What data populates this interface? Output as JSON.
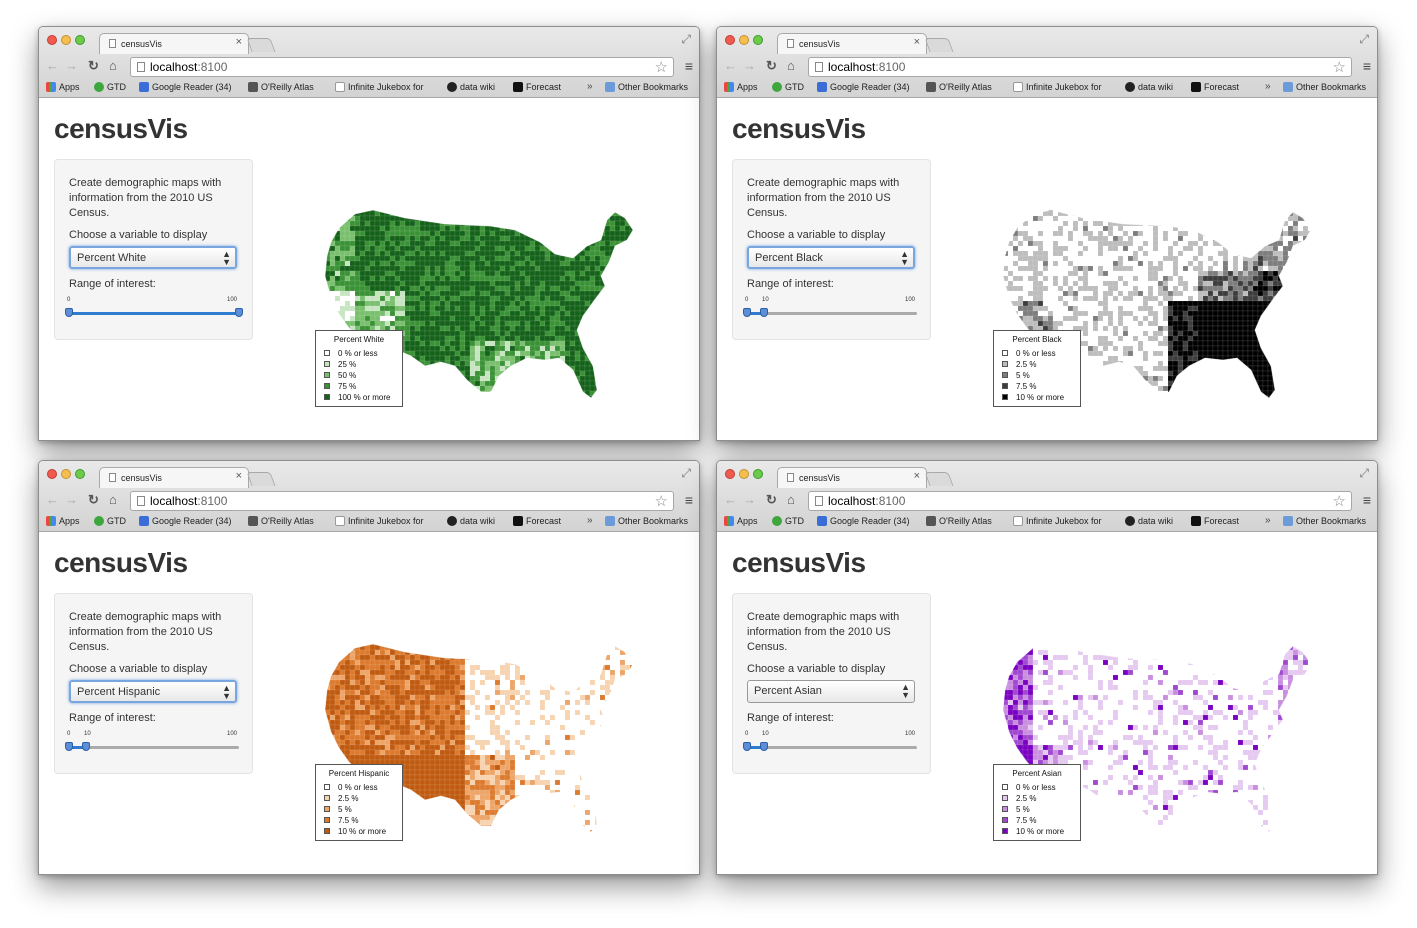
{
  "browser": {
    "tab_title": "censusVis",
    "url_host": "localhost",
    "url_port": ":8100",
    "bookmarks": [
      "Apps",
      "GTD",
      "Google Reader (34)",
      "O'Reilly Atlas",
      "Infinite Jukebox for",
      "data wiki",
      "Forecast"
    ],
    "bookmarks_overflow": "»",
    "other_bookmarks": "Other Bookmarks"
  },
  "app": {
    "title": "censusVis",
    "intro": "Create demographic maps with information from the 2010 US Census.",
    "variable_label": "Choose a variable to display",
    "range_label": "Range of interest:"
  },
  "windows": [
    {
      "variable": "Percent White",
      "slider": {
        "min": 0,
        "max": 100,
        "low": 0,
        "high": 100
      },
      "slider_ticks": [
        "0",
        "100"
      ],
      "select_focused": true,
      "legend_title": "Percent White",
      "legend": [
        "0 % or less",
        "25 %",
        "50 %",
        "75 %",
        "100 % or more"
      ],
      "colors": [
        "#ffffff",
        "#c7e5c1",
        "#79bf6e",
        "#3a9136",
        "#14611a"
      ]
    },
    {
      "variable": "Percent Black",
      "slider": {
        "min": 0,
        "max": 100,
        "low": 0,
        "high": 10
      },
      "slider_ticks": [
        "0",
        "10",
        "100"
      ],
      "select_focused": true,
      "legend_title": "Percent Black",
      "legend": [
        "0 % or less",
        "2.5 %",
        "5 %",
        "7.5 %",
        "10 % or more"
      ],
      "colors": [
        "#ffffff",
        "#bdbdbd",
        "#7d7d7d",
        "#3d3d3d",
        "#000000"
      ]
    },
    {
      "variable": "Percent Hispanic",
      "slider": {
        "min": 0,
        "max": 100,
        "low": 0,
        "high": 10
      },
      "slider_ticks": [
        "0",
        "10",
        "100"
      ],
      "select_focused": true,
      "legend_title": "Percent Hispanic",
      "legend": [
        "0 % or less",
        "2.5 %",
        "5 %",
        "7.5 %",
        "10 % or more"
      ],
      "colors": [
        "#ffffff",
        "#f7d3b0",
        "#eda568",
        "#dc7a2e",
        "#c05a10"
      ]
    },
    {
      "variable": "Percent Asian",
      "slider": {
        "min": 0,
        "max": 100,
        "low": 0,
        "high": 10
      },
      "slider_ticks": [
        "0",
        "10",
        "100"
      ],
      "select_focused": false,
      "legend_title": "Percent Asian",
      "legend": [
        "0 % or less",
        "2.5 %",
        "5 %",
        "7.5 %",
        "10 % or more"
      ],
      "colors": [
        "#ffffff",
        "#e5c9f0",
        "#c98ee0",
        "#a049d0",
        "#7a00c2"
      ]
    }
  ]
}
